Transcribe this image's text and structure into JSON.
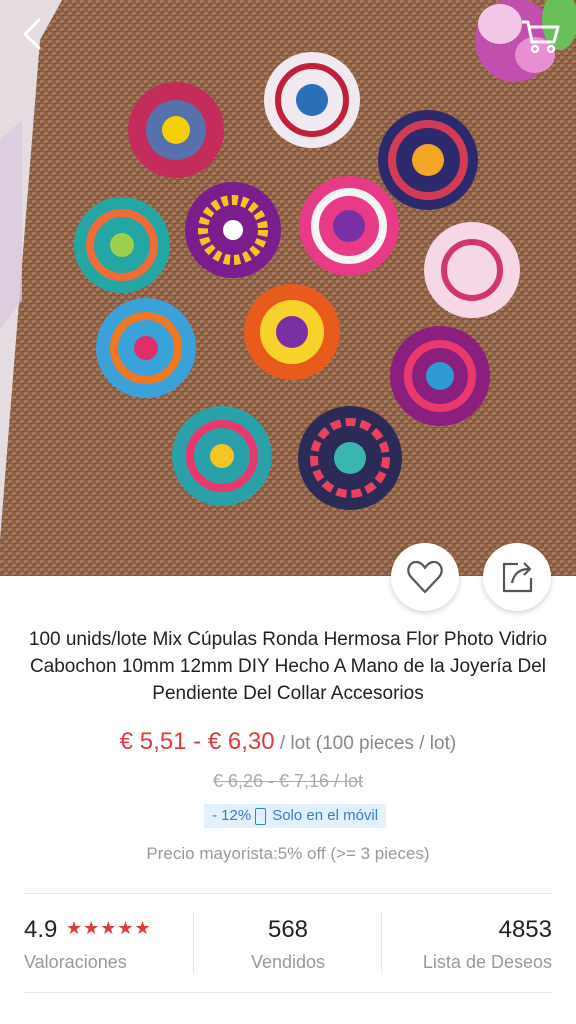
{
  "header": {
    "back_icon": "chevron-left-icon",
    "cart_icon": "shopping-cart-icon"
  },
  "hero": {
    "description_icons": [
      "heart-outline-icon",
      "share-icon"
    ]
  },
  "product": {
    "title": "100 unids/lote Mix Cúpulas Ronda Hermosa Flor Photo Vidrio Cabochon 10mm 12mm DIY Hecho A Mano de la Joyería Del Pendiente Del Collar Accesorios",
    "price_range": "€ 5,51 - € 6,30",
    "price_unit": " / lot (100 pieces / lot)",
    "old_price": "€ 6,26 - € 7,16 / lot",
    "promo_discount": "- 12%",
    "promo_text": "Solo en el móvil",
    "wholesale": "Precio mayorista:5% off (>= 3 pieces)"
  },
  "stats": {
    "rating_value": "4.9",
    "rating_stars": "★★★★★",
    "rating_label": "Valoraciones",
    "sold_value": "568",
    "sold_label": "Vendidos",
    "wishlist_value": "4853",
    "wishlist_label": "Lista de Deseos"
  },
  "colors": {
    "accent_red": "#e4393c",
    "promo_blue": "#3a7bd5",
    "promo_bg": "#e3f0fd"
  }
}
